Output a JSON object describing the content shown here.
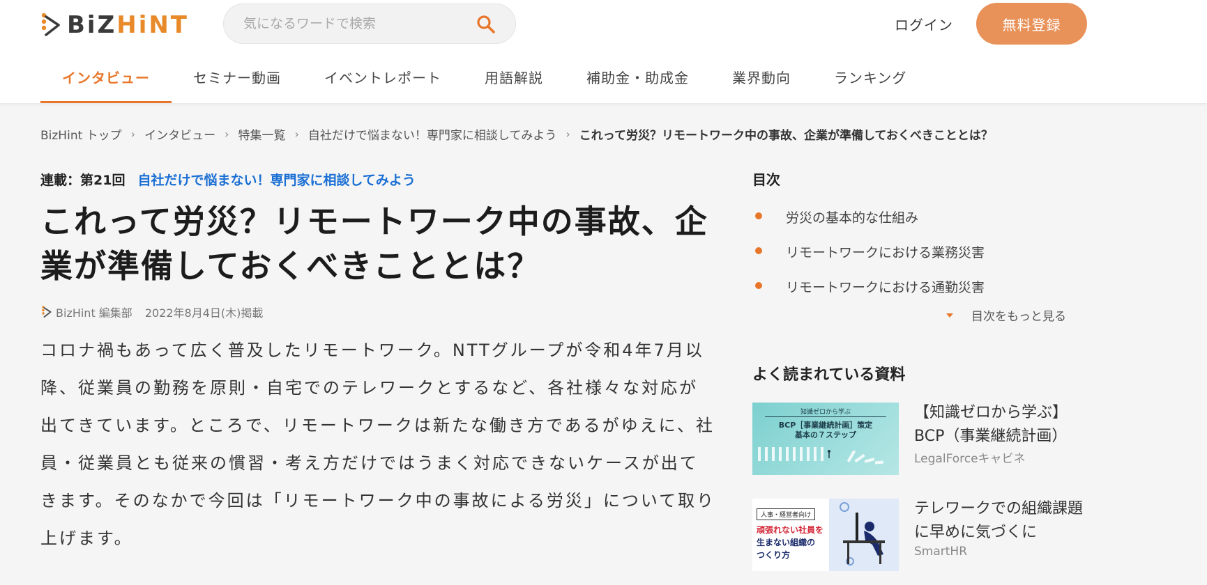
{
  "header": {
    "logo": {
      "text_left": "BiZ",
      "text_right": "HiNT"
    },
    "search": {
      "placeholder": "気になるワードで検索",
      "value": ""
    },
    "login_label": "ログイン",
    "register_label": "無料登録",
    "nav": [
      {
        "label": "インタビュー",
        "active": true
      },
      {
        "label": "セミナー動画",
        "active": false
      },
      {
        "label": "イベントレポート",
        "active": false
      },
      {
        "label": "用語解説",
        "active": false
      },
      {
        "label": "補助金・助成金",
        "active": false
      },
      {
        "label": "業界動向",
        "active": false
      },
      {
        "label": "ランキング",
        "active": false
      }
    ],
    "accent_color": "#e8762a"
  },
  "breadcrumb": [
    "BizHint トップ",
    "インタビュー",
    "特集一覧",
    "自社だけで悩まない！専門家に相談してみよう",
    "これって労災？リモートワーク中の事故、企業が準備しておくべきこととは？"
  ],
  "article": {
    "series_label": "連載：第21回",
    "series_name": "自社だけで悩まない！専門家に相談してみよう",
    "title": "これって労災？リモートワーク中の事故、企業が準備しておくべきこととは？",
    "author": "BizHint 編集部",
    "date": "2022年8月4日(木)掲載",
    "lead": "コロナ禍もあって広く普及したリモートワーク。NTTグループが令和4年7月以降、従業員の勤務を原則・自宅でのテレワークとするなど、各社様々な対応が出てきています。ところで、リモートワークは新たな働き方であるがゆえに、社員・従業員とも従来の慣習・考え方だけではうまく対応できないケースが出てきます。そのなかで今回は「リモートワーク中の事故による労災」について取り上げます。"
  },
  "toc": {
    "heading": "目次",
    "items": [
      "労災の基本的な仕組み",
      "リモートワークにおける業務災害",
      "リモートワークにおける通勤災害"
    ],
    "more_label": "目次をもっと見る"
  },
  "popular": {
    "heading": "よく読まれている資料",
    "items": [
      {
        "title": "【知識ゼロから学ぶ】BCP（事業継続計画）",
        "company": "LegalForceキャビネ",
        "thumb": {
          "small": "知識ゼロから学ぶ",
          "line1": "BCP［事業継続計画］策定",
          "line2": "基本の７ステップ"
        }
      },
      {
        "title": "テレワークでの組織課題に早めに気づくに",
        "company": "SmartHR",
        "thumb": {
          "tag": "人事・経営者向け",
          "line1": "頑張れない社員を",
          "line2": "生まない組織の",
          "line3": "つくり方"
        }
      }
    ]
  }
}
